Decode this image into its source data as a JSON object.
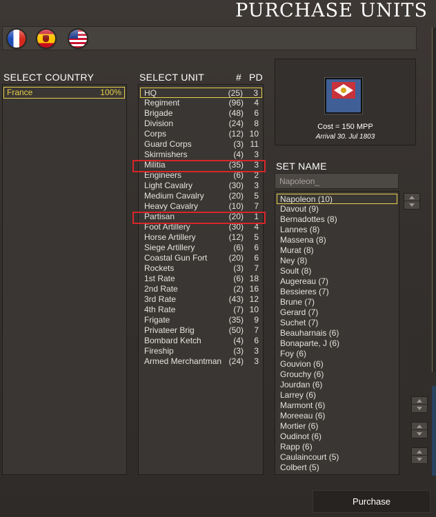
{
  "title": "PURCHASE UNITS",
  "flags": [
    "france-flag-icon",
    "spain-flag-icon",
    "usa-flag-icon"
  ],
  "select_country": {
    "header": "SELECT COUNTRY",
    "items": [
      {
        "name": "France",
        "percent": "100%"
      }
    ]
  },
  "select_unit": {
    "header": "SELECT UNIT",
    "col_count": "#",
    "col_pd": "PD",
    "items": [
      {
        "name": "HQ",
        "count": "(25)",
        "pd": "3"
      },
      {
        "name": "Regiment",
        "count": "(96)",
        "pd": "4"
      },
      {
        "name": "Brigade",
        "count": "(48)",
        "pd": "6"
      },
      {
        "name": "Division",
        "count": "(24)",
        "pd": "8"
      },
      {
        "name": "Corps",
        "count": "(12)",
        "pd": "10"
      },
      {
        "name": "Guard Corps",
        "count": "(3)",
        "pd": "11"
      },
      {
        "name": "Skirmishers",
        "count": "(4)",
        "pd": "3"
      },
      {
        "name": "Militia",
        "count": "(35)",
        "pd": "3"
      },
      {
        "name": "Engineers",
        "count": "(6)",
        "pd": "2"
      },
      {
        "name": "Light Cavalry",
        "count": "(30)",
        "pd": "3"
      },
      {
        "name": "Medium Cavalry",
        "count": "(20)",
        "pd": "5"
      },
      {
        "name": "Heavy Cavalry",
        "count": "(10)",
        "pd": "7"
      },
      {
        "name": "Partisan",
        "count": "(20)",
        "pd": "1"
      },
      {
        "name": "Foot Artillery",
        "count": "(30)",
        "pd": "4"
      },
      {
        "name": "Horse Artillery",
        "count": "(12)",
        "pd": "5"
      },
      {
        "name": "Siege Artillery",
        "count": "(6)",
        "pd": "6"
      },
      {
        "name": "Coastal Gun Fort",
        "count": "(20)",
        "pd": "6"
      },
      {
        "name": "Rockets",
        "count": "(3)",
        "pd": "7"
      },
      {
        "name": "1st Rate",
        "count": "(6)",
        "pd": "18"
      },
      {
        "name": "2nd Rate",
        "count": "(2)",
        "pd": "16"
      },
      {
        "name": "3rd Rate",
        "count": "(43)",
        "pd": "12"
      },
      {
        "name": "4th Rate",
        "count": "(7)",
        "pd": "10"
      },
      {
        "name": "Frigate",
        "count": "(35)",
        "pd": "9"
      },
      {
        "name": "Privateer Brig",
        "count": "(50)",
        "pd": "7"
      },
      {
        "name": "Bombard Ketch",
        "count": "(4)",
        "pd": "6"
      },
      {
        "name": "Fireship",
        "count": "(3)",
        "pd": "3"
      },
      {
        "name": "Armed Merchantman",
        "count": "(24)",
        "pd": "3"
      }
    ]
  },
  "preview": {
    "cost": "Cost = 150 MPP",
    "arrival": "Arrival 30. Jul 1803"
  },
  "set_name": {
    "header": "SET NAME",
    "input_value": "Napoleon_",
    "items": [
      "Napoleon (10)",
      "Davout (9)",
      "Bernadottes (8)",
      "Lannes (8)",
      "Massena (8)",
      "Murat (8)",
      "Ney (8)",
      "Soult (8)",
      "Augereau (7)",
      "Bessieres (7)",
      "Brune (7)",
      "Gerard (7)",
      "Suchet (7)",
      "Beauharnais (6)",
      "Bonaparte, J (6)",
      "Foy (6)",
      "Gouvion (6)",
      "Grouchy (6)",
      "Jourdan (6)",
      "Larrey (6)",
      "Marmont (6)",
      "Moreeau (6)",
      "Mortier (6)",
      "Oudinot (6)",
      "Rapp (6)",
      "Caulaincourt (5)",
      "Colbert (5)"
    ]
  },
  "purchase_label": "Purchase"
}
